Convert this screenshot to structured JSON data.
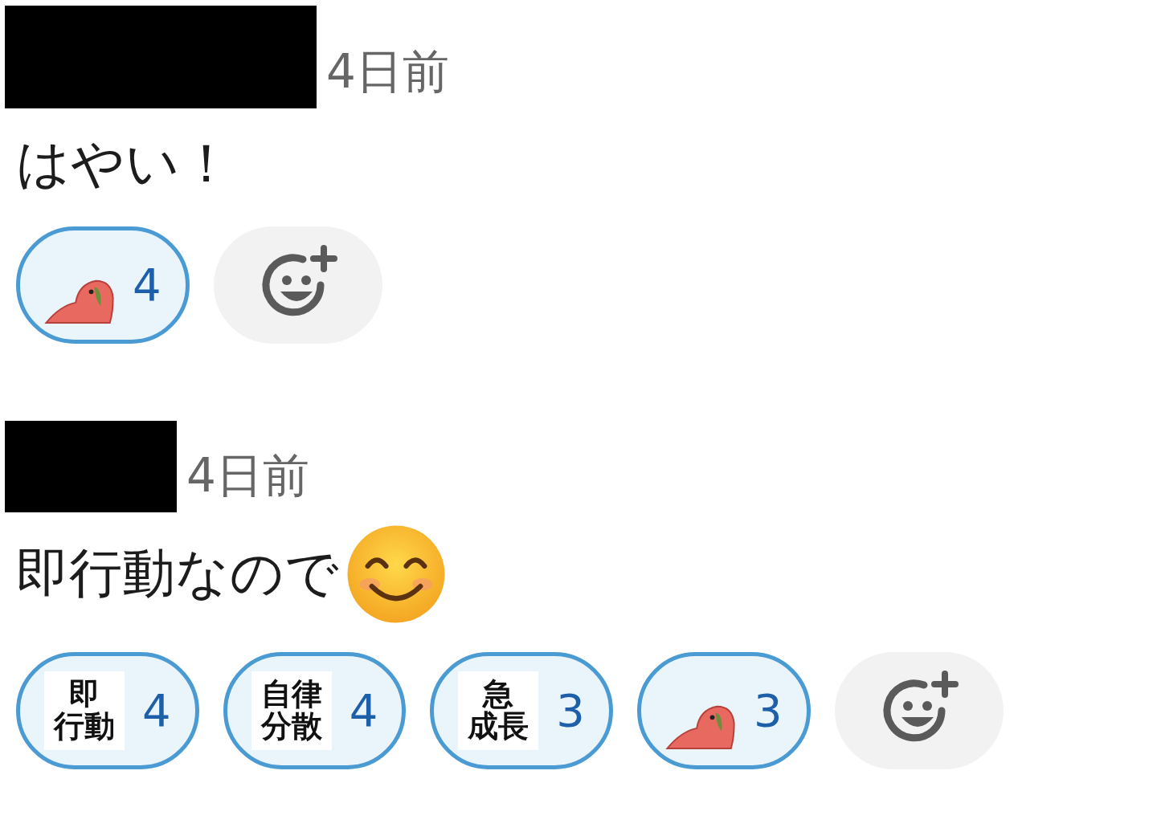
{
  "messages": [
    {
      "author_redacted": true,
      "time": "4日前",
      "content": [
        {
          "kind": "text",
          "text": "はやい！"
        }
      ],
      "reactions": [
        {
          "kind": "parrot",
          "count": "4",
          "selected": true
        }
      ]
    },
    {
      "author_redacted": true,
      "time": "4日前",
      "content": [
        {
          "kind": "text",
          "text": "即行動なので"
        },
        {
          "kind": "emoji"
        }
      ],
      "reactions": [
        {
          "kind": "text",
          "lines": [
            "即",
            "行動"
          ],
          "count": "4",
          "selected": true
        },
        {
          "kind": "text",
          "lines": [
            "自律",
            "分散"
          ],
          "count": "4",
          "selected": true
        },
        {
          "kind": "text",
          "lines": [
            "急",
            "成長"
          ],
          "count": "3",
          "selected": true
        },
        {
          "kind": "parrot",
          "count": "3",
          "selected": true
        }
      ]
    }
  ]
}
